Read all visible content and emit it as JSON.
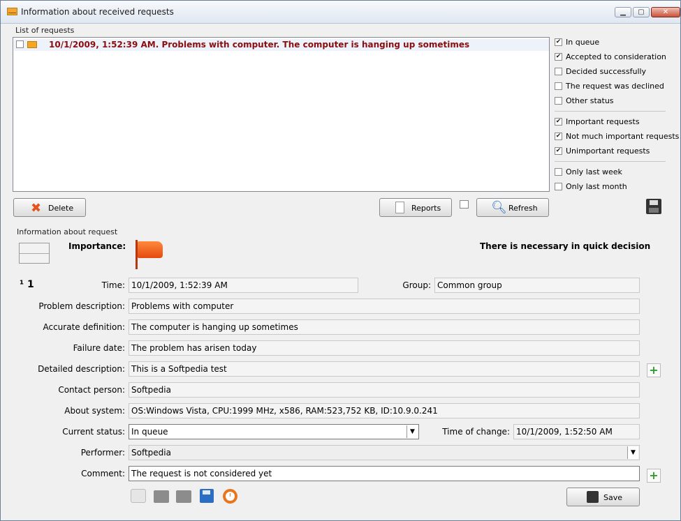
{
  "window": {
    "title": "Information about received requests"
  },
  "list": {
    "group_label": "List of requests",
    "rows": [
      {
        "text": "10/1/2009, 1:52:39 AM. Problems with computer. The computer is hanging up sometimes"
      }
    ]
  },
  "filters": {
    "status": [
      {
        "label": "In queue",
        "checked": true
      },
      {
        "label": "Accepted to consideration",
        "checked": true
      },
      {
        "label": "Decided successfully",
        "checked": false
      },
      {
        "label": "The request was declined",
        "checked": false
      },
      {
        "label": "Other status",
        "checked": false
      }
    ],
    "importance": [
      {
        "label": "Important requests",
        "checked": true
      },
      {
        "label": "Not much important requests",
        "checked": true
      },
      {
        "label": "Unimportant requests",
        "checked": true
      }
    ],
    "period": [
      {
        "label": "Only last week",
        "checked": false
      },
      {
        "label": "Only last month",
        "checked": false
      }
    ]
  },
  "buttons": {
    "delete": "Delete",
    "reports": "Reports",
    "refresh": "Refresh",
    "save": "Save"
  },
  "info": {
    "group_label": "Information about request",
    "importance_label": "Importance:",
    "decision_text": "There is necessary in quick decision",
    "number": "¹ 1",
    "time_label": "Time:",
    "time_value": "10/1/2009, 1:52:39 AM",
    "group_label_f": "Group:",
    "group_value": "Common group",
    "problem_label": "Problem description:",
    "problem_value": "Problems with computer",
    "accurate_label": "Accurate definition:",
    "accurate_value": "The computer is hanging up sometimes",
    "failure_label": "Failure date:",
    "failure_value": "The problem has arisen today",
    "detailed_label": "Detailed description:",
    "detailed_value": "This is a Softpedia test",
    "contact_label": "Contact person:",
    "contact_value": "Softpedia",
    "system_label": "About system:",
    "system_value": "OS:Windows Vista, CPU:1999 MHz, x586, RAM:523,752 KB, ID:10.9.0.241",
    "status_label": "Current status:",
    "status_value": "In queue",
    "change_label": "Time of change:",
    "change_value": "10/1/2009, 1:52:50 AM",
    "performer_label": "Performer:",
    "performer_value": "Softpedia",
    "comment_label": "Comment:",
    "comment_value": "The request is not considered yet"
  }
}
